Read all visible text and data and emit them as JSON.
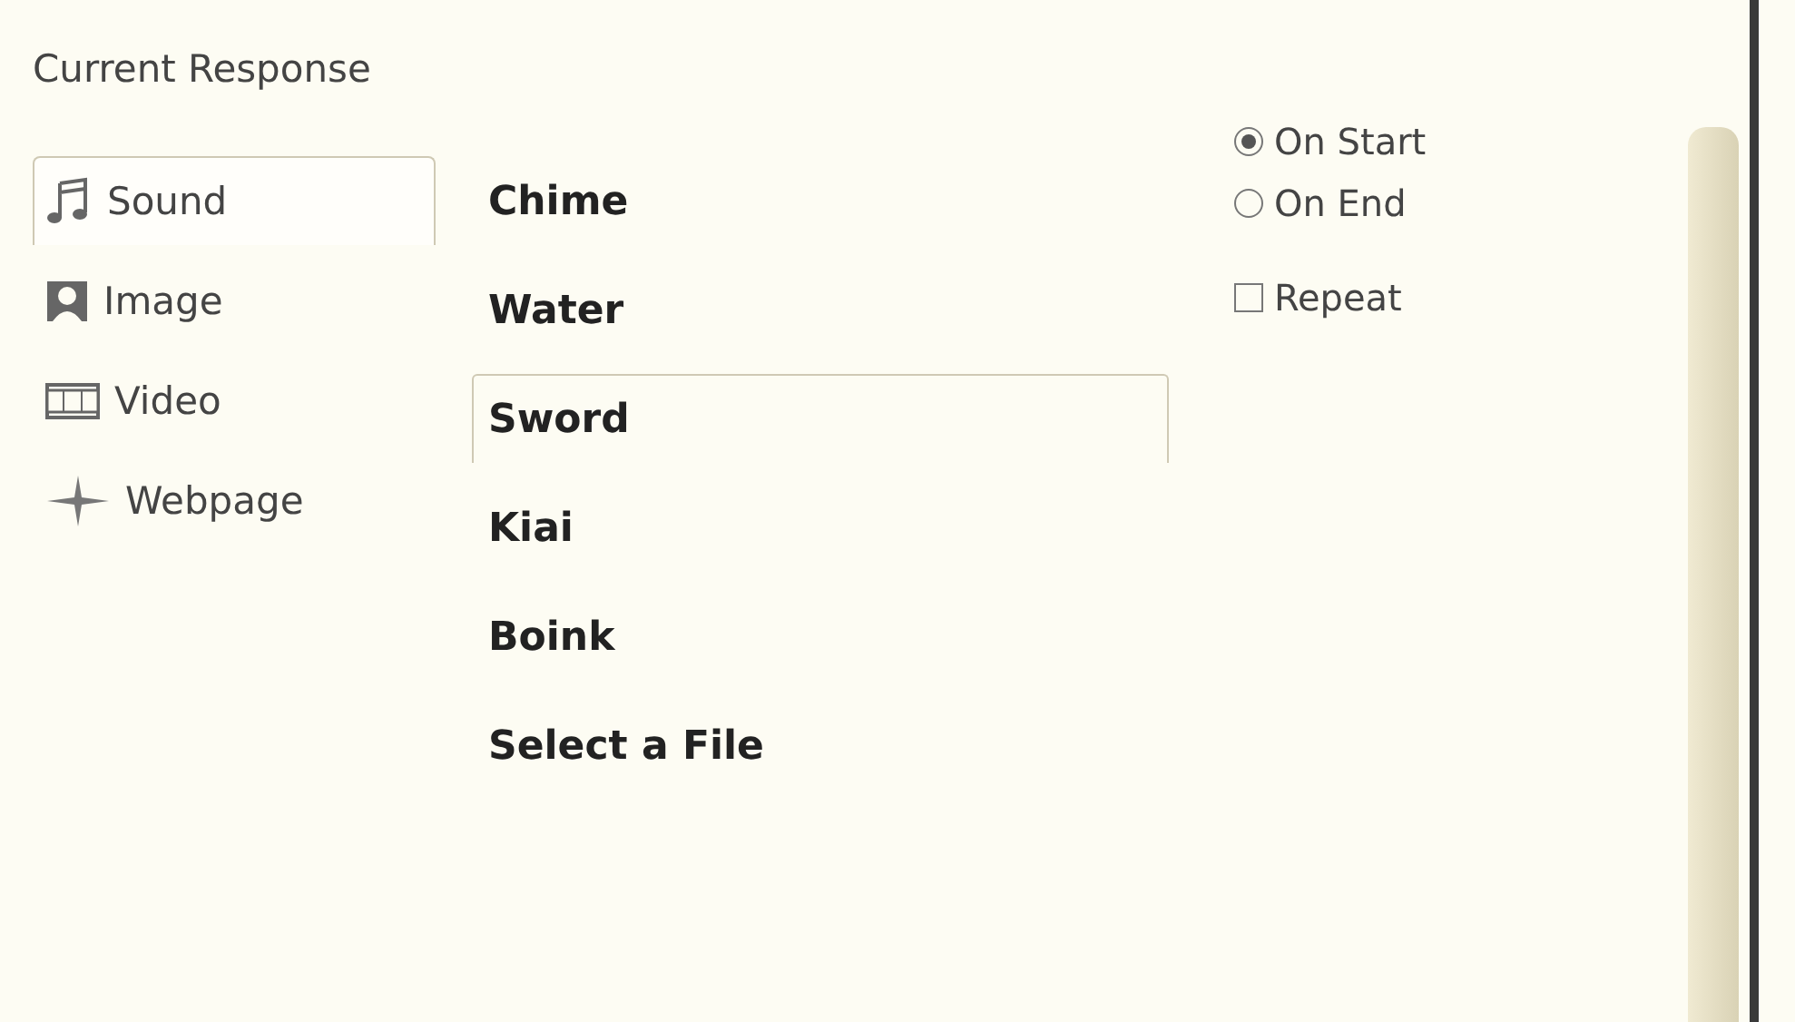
{
  "panel": {
    "title": "Current Response"
  },
  "media_types": [
    {
      "kind": "sound",
      "label": "Sound",
      "selected": true
    },
    {
      "kind": "image",
      "label": "Image",
      "selected": false
    },
    {
      "kind": "video",
      "label": "Video",
      "selected": false
    },
    {
      "kind": "webpage",
      "label": "Webpage",
      "selected": false
    }
  ],
  "sounds": [
    {
      "label": "Chime",
      "selected": false
    },
    {
      "label": "Water",
      "selected": false
    },
    {
      "label": "Sword",
      "selected": true
    },
    {
      "label": "Kiai",
      "selected": false
    },
    {
      "label": "Boink",
      "selected": false
    },
    {
      "label": "Select a File",
      "selected": false
    }
  ],
  "play_timing": [
    {
      "label": "On Start",
      "selected": true
    },
    {
      "label": "On End",
      "selected": false
    }
  ],
  "repeat": {
    "label": "Repeat",
    "checked": false
  }
}
